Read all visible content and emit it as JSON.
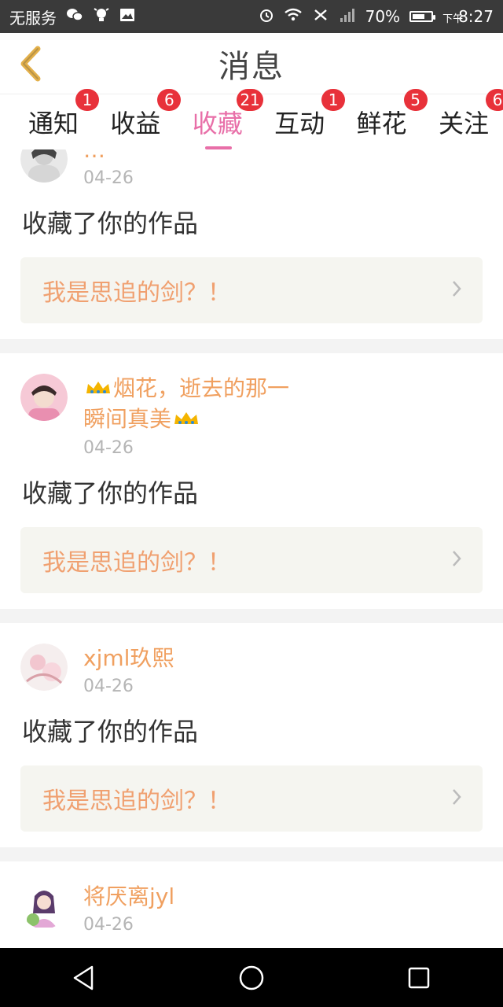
{
  "status_bar": {
    "carrier": "无服务",
    "battery": "70%",
    "time_prefix": "下午",
    "time": "8:27",
    "battery_level": 0.7,
    "icons": [
      "wechat-icon",
      "bulb-icon",
      "image-icon",
      "alarm-icon",
      "wifi-icon",
      "no-call-icon",
      "signal-icon",
      "battery-icon"
    ]
  },
  "header": {
    "title": "消息",
    "back_icon": "chevron-left-icon"
  },
  "tabs": [
    {
      "label": "通知",
      "badge": "1"
    },
    {
      "label": "收益",
      "badge": "6"
    },
    {
      "label": "收藏",
      "badge": "21",
      "active": true
    },
    {
      "label": "互动",
      "badge": "1"
    },
    {
      "label": "鲜花",
      "badge": "5"
    },
    {
      "label": "关注",
      "badge": "6"
    }
  ],
  "items": [
    {
      "user_name": "…",
      "date": "04-26",
      "message": "收藏了你的作品",
      "work_title": "我是思追的剑？！"
    },
    {
      "user_name_line1": "烟花，逝去的那一",
      "user_name_line2": "瞬间真美",
      "date": "04-26",
      "message": "收藏了你的作品",
      "work_title": "我是思追的剑？！"
    },
    {
      "user_name": "xjml玖熙",
      "date": "04-26",
      "message": "收藏了你的作品",
      "work_title": "我是思追的剑？！"
    },
    {
      "user_name": "将厌离jyl",
      "date": "04-26"
    }
  ],
  "nav": {
    "back": "back-triangle-icon",
    "home": "home-circle-icon",
    "recent": "recent-square-icon"
  },
  "colors": {
    "accent": "#e86fa8",
    "badge": "#e8313a",
    "username": "#f0a060",
    "work_title": "#f0a070"
  }
}
